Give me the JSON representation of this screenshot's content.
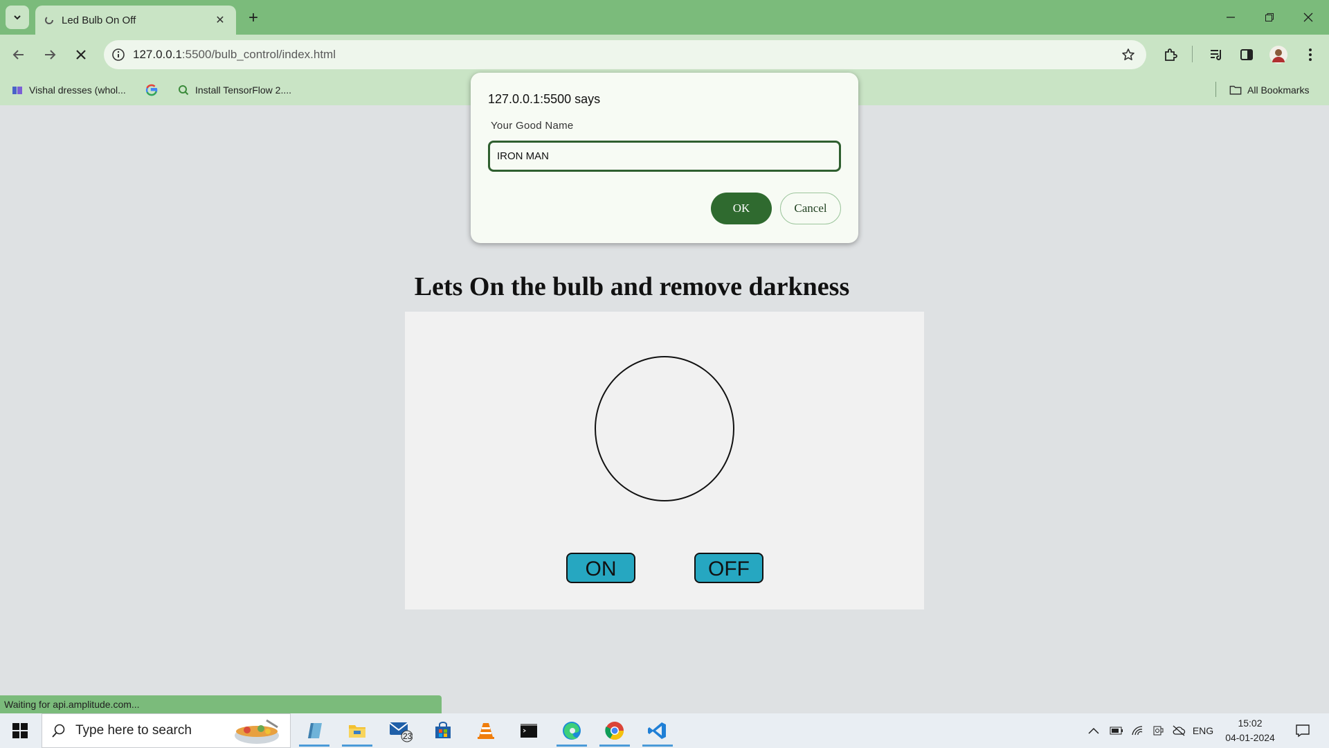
{
  "browser": {
    "tab": {
      "title": "Led Bulb On Off"
    },
    "address": {
      "host": "127.0.0.1",
      "path": ":5500/bulb_control/index.html"
    },
    "bookmarks": [
      {
        "label": "Vishal dresses (whol..."
      },
      {
        "label": ""
      },
      {
        "label": "Install TensorFlow 2...."
      }
    ],
    "all_bookmarks_label": "All Bookmarks",
    "status_text": "Waiting for api.amplitude.com..."
  },
  "dialog": {
    "title": "127.0.0.1:5500 says",
    "message": "Your Good Name",
    "input_value": "IRON MAN",
    "ok_label": "OK",
    "cancel_label": "Cancel"
  },
  "page": {
    "heading": "Lets On the bulb and remove darkness",
    "on_label": "ON",
    "off_label": "OFF"
  },
  "taskbar": {
    "search_placeholder": "Type here to search",
    "mail_badge": "23",
    "language": "ENG",
    "time": "15:02",
    "date": "04-01-2024"
  },
  "colors": {
    "chrome_frame": "#7bbb7b",
    "chrome_toolbar": "#c9e4c5",
    "dialog_ok": "#2f6a2f",
    "button_fill": "#26a7c1"
  }
}
